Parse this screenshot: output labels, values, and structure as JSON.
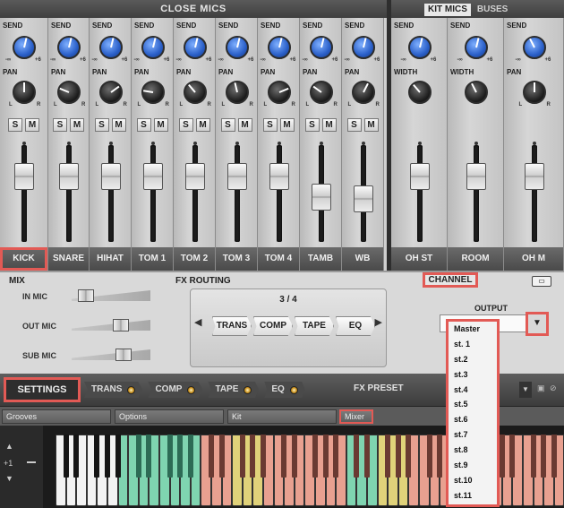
{
  "mixer": {
    "close_mics_title": "CLOSE MICS",
    "kit_tabs": [
      {
        "label": "KIT MICS",
        "active": true
      },
      {
        "label": "BUSES",
        "active": false
      }
    ],
    "send_label": "SEND",
    "pan_label": "PAN",
    "width_label": "WIDTH",
    "scale": {
      "min": "-∞",
      "max": "+6",
      "left": "L",
      "right": "R"
    },
    "solo_label": "S",
    "mute_label": "M",
    "close_channels": [
      {
        "name": "KICK",
        "send_level": 0.55,
        "pan": 0.5,
        "fader_level": 0.74,
        "highlighted": true
      },
      {
        "name": "SNARE",
        "send_level": 0.55,
        "pan": 0.25,
        "fader_level": 0.74
      },
      {
        "name": "HIHAT",
        "send_level": 0.55,
        "pan": 0.7,
        "fader_level": 0.74
      },
      {
        "name": "TOM 1",
        "send_level": 0.55,
        "pan": 0.2,
        "fader_level": 0.74
      },
      {
        "name": "TOM 2",
        "send_level": 0.55,
        "pan": 0.35,
        "fader_level": 0.74
      },
      {
        "name": "TOM 3",
        "send_level": 0.55,
        "pan": 0.45,
        "fader_level": 0.74
      },
      {
        "name": "TOM 4",
        "send_level": 0.55,
        "pan": 0.75,
        "fader_level": 0.74
      },
      {
        "name": "TAMB",
        "send_level": 0.55,
        "pan": 0.3,
        "fader_level": 0.45
      },
      {
        "name": "WB",
        "send_level": 0.55,
        "pan": 0.6,
        "fader_level": 0.42
      }
    ],
    "kit_channels": [
      {
        "name": "OH ST",
        "send_level": 0.55,
        "second": "width",
        "second_value": 0.35,
        "fader_level": 0.74
      },
      {
        "name": "ROOM",
        "send_level": 0.55,
        "second": "width",
        "second_value": 0.4,
        "fader_level": 0.74
      },
      {
        "name": "OH M",
        "send_level": 0.4,
        "second": "pan",
        "second_value": 0.5,
        "fader_level": 0.74
      }
    ]
  },
  "channel": {
    "mix_title": "MIX",
    "mix_rows": [
      {
        "label": "IN MIC",
        "level": 0.1
      },
      {
        "label": "OUT MIC",
        "level": 0.65
      },
      {
        "label": "SUB MIC",
        "level": 0.7
      }
    ],
    "fx_routing_title": "FX ROUTING",
    "fx_page": "3 / 4",
    "fx_modules": [
      "TRANS",
      "COMP",
      "TAPE",
      "EQ"
    ],
    "channel_label": "CHANNEL",
    "output_label": "OUTPUT",
    "output_value": "",
    "output_options": [
      "Master",
      "st. 1",
      "st.2",
      "st.3",
      "st.4",
      "st.5",
      "st.6",
      "st.7",
      "st.8",
      "st.9",
      "st.10",
      "st.11"
    ]
  },
  "settings_bar": {
    "settings_label": "SETTINGS",
    "fx_chain": [
      "TRANS",
      "COMP",
      "TAPE",
      "EQ"
    ],
    "fx_preset_label": "FX PRESET"
  },
  "page_tabs": [
    {
      "label": "Grooves",
      "active": false
    },
    {
      "label": "Options",
      "active": false
    },
    {
      "label": "Kit",
      "active": false
    },
    {
      "label": "Mixer",
      "active": true
    }
  ],
  "keyboard": {
    "octave": "+1"
  },
  "colors": {
    "highlight": "#e25a55",
    "send_knob": "#2a5fc8",
    "key_green": "#7fd4b0",
    "key_salmon": "#e8a090",
    "key_yellow": "#e0d27a"
  }
}
